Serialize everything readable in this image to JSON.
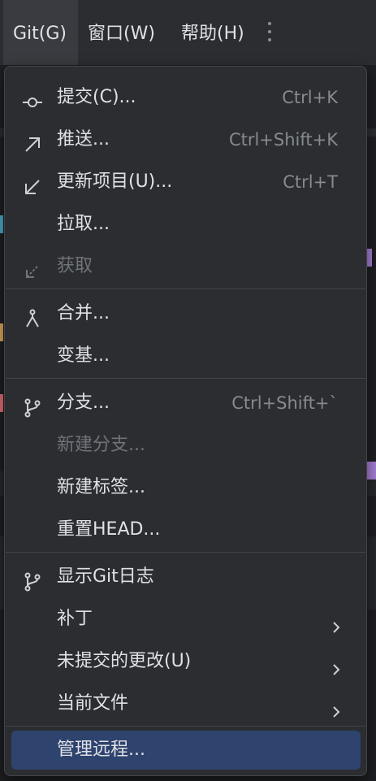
{
  "menubar": {
    "git": "Git(G)",
    "window": "窗口(W)",
    "help": "帮助(H)"
  },
  "menu": {
    "commit": {
      "label": "提交(C)...",
      "shortcut": "Ctrl+K",
      "icon": "commit-icon"
    },
    "push": {
      "label": "推送...",
      "shortcut": "Ctrl+Shift+K",
      "icon": "push-arrow-icon"
    },
    "update": {
      "label": "更新项目(U)...",
      "shortcut": "Ctrl+T",
      "icon": "update-arrow-icon"
    },
    "pull": {
      "label": "拉取..."
    },
    "fetch": {
      "label": "获取",
      "icon": "fetch-icon",
      "disabled": true
    },
    "merge": {
      "label": "合并...",
      "icon": "merge-icon"
    },
    "rebase": {
      "label": "变基..."
    },
    "branches": {
      "label": "分支...",
      "shortcut": "Ctrl+Shift+`",
      "icon": "branch-icon"
    },
    "new_branch": {
      "label": "新建分支...",
      "disabled": true
    },
    "new_tag": {
      "label": "新建标签..."
    },
    "reset_head": {
      "label": "重置HEAD..."
    },
    "show_log": {
      "label": "显示Git日志",
      "icon": "branch-icon"
    },
    "patch": {
      "label": "补丁"
    },
    "uncommitted": {
      "label": "未提交的更改(U)"
    },
    "current_file": {
      "label": "当前文件"
    },
    "manage_remotes": {
      "label": "管理远程..."
    }
  },
  "colors": {
    "background": "#2b2d30",
    "selection": "#2e436e",
    "separator": "#43454a",
    "text": "#dfe1e5",
    "shortcut": "#868a91",
    "disabled": "#6f737a"
  }
}
